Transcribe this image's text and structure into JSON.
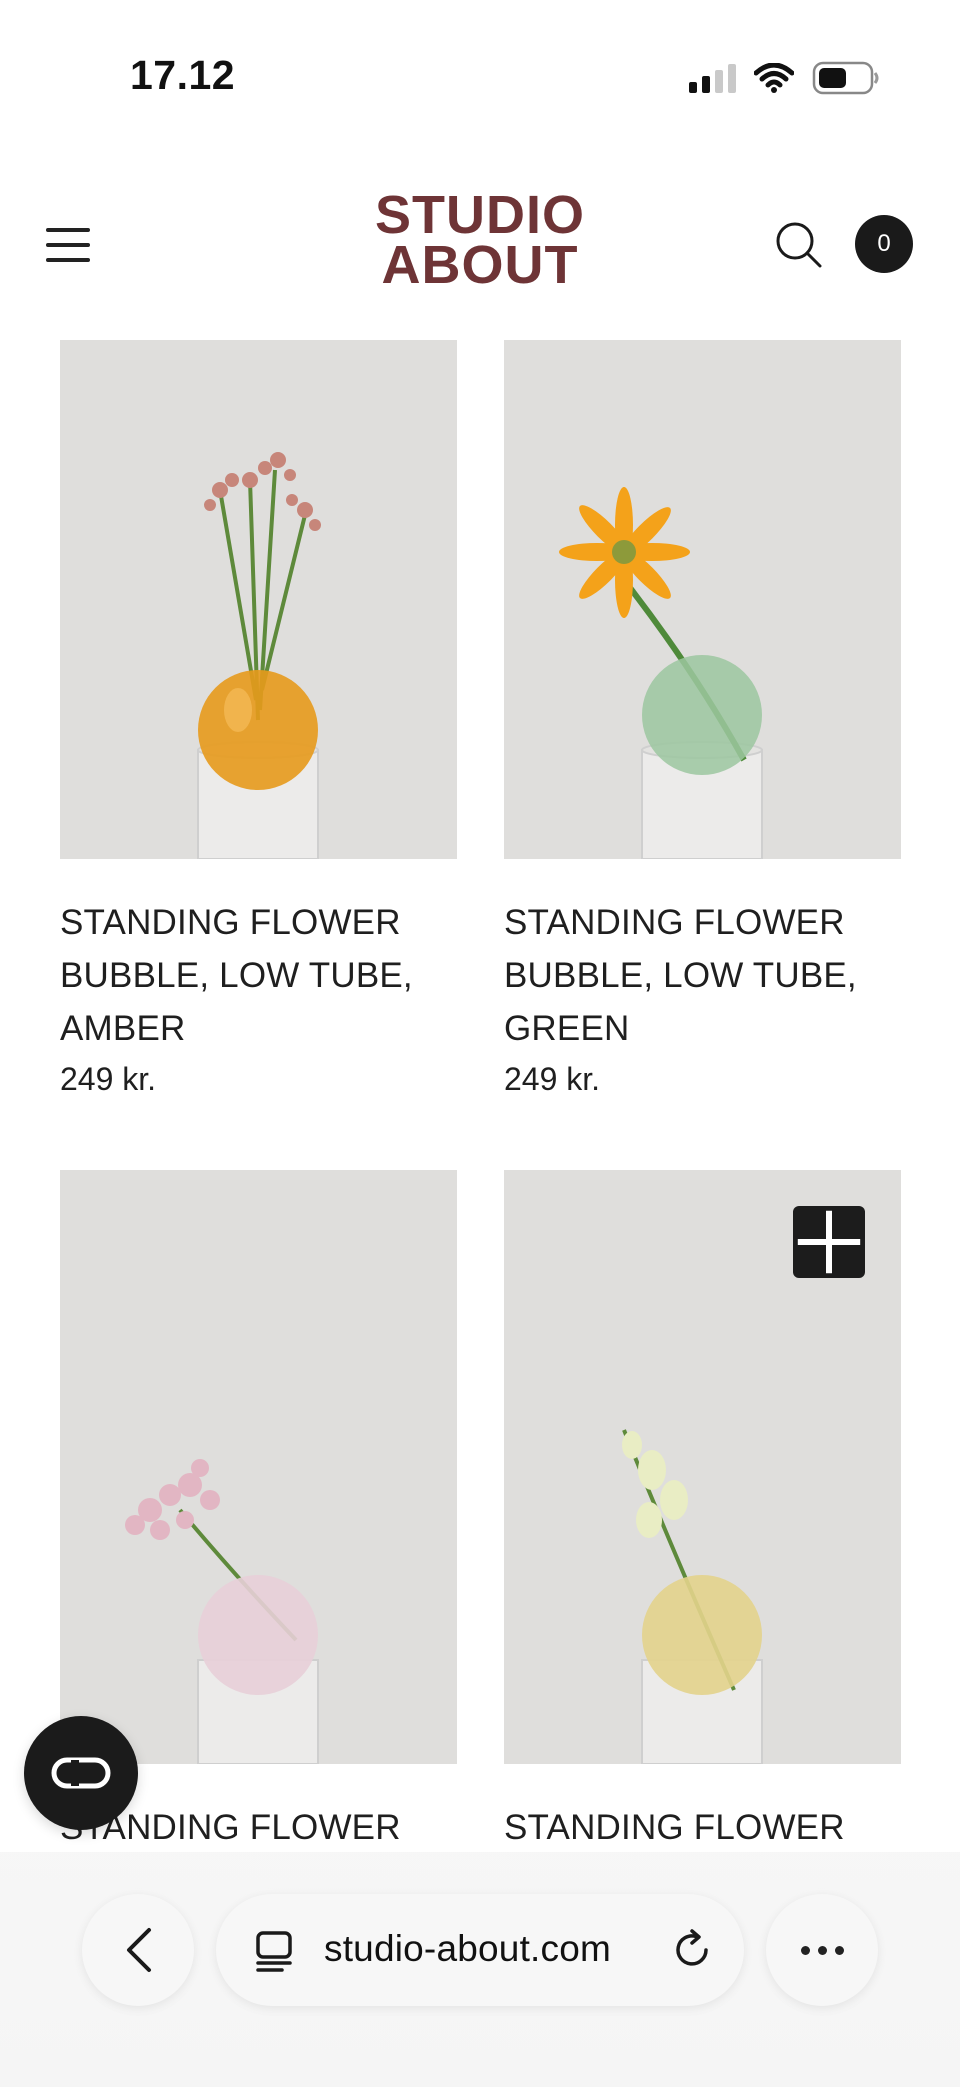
{
  "status_bar": {
    "time": "17.12",
    "icons": [
      "signal-icon",
      "wifi-icon",
      "battery-icon"
    ]
  },
  "header": {
    "logo_line1": "STUDIO",
    "logo_line2": "ABOUT",
    "cart_count": "0",
    "brand_color": "#6e3436"
  },
  "products": [
    {
      "title": "STANDING FLOWER BUBBLE, LOW TUBE, AMBER",
      "price": "249 kr.",
      "glass_color": "#e79a1c"
    },
    {
      "title": "STANDING FLOWER BUBBLE, LOW TUBE, GREEN",
      "price": "249 kr.",
      "glass_color": "#9cc7a0"
    },
    {
      "title": "STANDING FLOWER",
      "price": "",
      "glass_color": "#e8cfd8"
    },
    {
      "title": "STANDING FLOWER",
      "price": "",
      "glass_color": "#e3d38c"
    }
  ],
  "browser": {
    "url": "studio-about.com"
  }
}
